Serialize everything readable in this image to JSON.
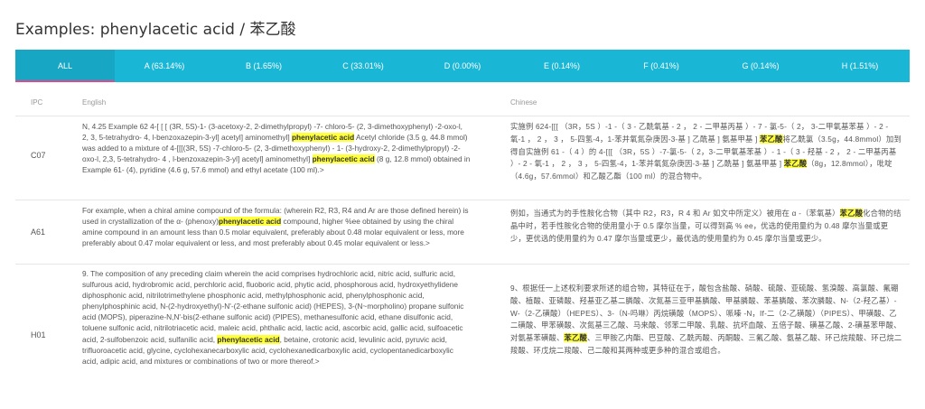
{
  "title": "Examples: phenylacetic acid / 苯乙酸",
  "tabs": [
    {
      "label": "ALL",
      "active": true
    },
    {
      "label": "A (63.14%)"
    },
    {
      "label": "B (1.65%)"
    },
    {
      "label": "C (33.01%)"
    },
    {
      "label": "D (0.00%)"
    },
    {
      "label": "E (0.14%)"
    },
    {
      "label": "F (0.41%)"
    },
    {
      "label": "G (0.14%)"
    },
    {
      "label": "H (1.51%)"
    }
  ],
  "columns": {
    "ipc": "IPC",
    "english": "English",
    "chinese": "Chinese"
  },
  "rows": [
    {
      "ipc": "C07",
      "en_parts": [
        {
          "t": "N, 4.25 Example 62 4-[ [ [ (3R, 5S)-1- (3-acetoxy-2, 2-dimethylpropyl) -7- chloro-5- (2, 3-dimethoxyphenyl) -2-oxo-l, 2, 3, 5-tetrahydro- 4, l-benzoxazepin-3-yl] acetyl] aminomethyl] "
        },
        {
          "t": "phenylacetic acid",
          "hl": true
        },
        {
          "t": " Acetyl chloride (3.5 g, 44.8 mmol) was added to a mixture of 4-[[[(3R, 5S) -7-chloro-5- (2, 3-dimethoxyphenyl) - 1- (3-hydroxy-2, 2-dimethylpropyl) -2-oxo-l, 2,3, 5-tetrahydro- 4 , l-benzoxazepin-3-yl] acetyl] aminomethyl] "
        },
        {
          "t": "phenylacetic acid",
          "hl": true
        },
        {
          "t": " (8 g, 12.8 mmol) obtained in Example 61- (4), pyridine (4.6 g, 57.6 mmol) and ethyl acetate (100 ml).>"
        }
      ],
      "zh_parts": [
        {
          "t": "实施例 624-[[[ （3R，5S ）-1 -（ 3 - 乙酰氧基 - 2 ， 2 - 二甲基丙基 ）- 7 - 氯-5-（ 2， 3-二甲氧基苯基 ）- 2 - 氧-1 ， 2 ， 3 ， 5-四氢-4，1-苯并氧氮杂庚因-3-基 ] 乙酰基 ] 氨基甲基 ] "
        },
        {
          "t": "苯乙酸",
          "hl": true
        },
        {
          "t": "将乙酰氯（3.5g，44.8mmol）加到得自实施例 61 -（ 4 ）的 4-[[[ （3R，5S ）-7-氯-5-（ 2，3-二甲氧基苯基 ）- 1 -（ 3 - 羟基 - 2 ， 2 - 二甲基丙基 ）- 2 - 氧-1 ， 2 ， 3 ， 5-四氢-4，1-苯并氧氮杂庚因-3-基 ] 乙酰基 ] 氨基甲基 ] "
        },
        {
          "t": "苯乙酸",
          "hl": true
        },
        {
          "t": "（8g，12.8mmol），吡啶（4.6g，57.6mmol）和乙酸乙酯（100 ml）的混合物中。"
        }
      ]
    },
    {
      "ipc": "A61",
      "en_parts": [
        {
          "t": "For example, when a chiral amine compound of the formula: (wherein R2, R3, R4 and Ar are those defined herein) is used in crystallization of the α- (phenoxy)"
        },
        {
          "t": "phenylacetic acid",
          "hl": true
        },
        {
          "t": " compound, higher %ee obtained by using the chiral amine compound in an amount less than 0.5 molar equivalent, preferably about 0.48 molar equivalent or less, more preferably about 0.47 molar equivalent or less, and most preferably about 0.45 molar equivalent or less.>"
        }
      ],
      "zh_parts": [
        {
          "t": "例如，当通式为的手性胺化合物（其中 R2，R3，R 4 和 Ar 如文中所定义）被用在 α -（苯氧基）"
        },
        {
          "t": "苯乙酸",
          "hl": true
        },
        {
          "t": "化合物的结晶中时，若手性胺化合物的使用量小于 0.5 摩尔当量，可以得到高 % ee，优选的使用量约为 0.48 摩尔当量或更少，更优选的使用量约为 0.47 摩尔当量或更少，最优选的使用量约为 0.45 摩尔当量或更少。"
        }
      ]
    },
    {
      "ipc": "H01",
      "en_parts": [
        {
          "t": "9. The composition of any preceding claim wherein the acid comprises hydrochloric acid, nitric acid, sulfuric acid, sulfurous acid, hydrobromic acid, perchloric acid, fluoboric acid, phytic acid, phosphorous acid, hydroxyethylidene diphosphonic acid, nitrilotrimethylene phosphonic acid, methylphosphonic acid, phenylphosphonic acid, phenylphosphinic acid, N-(2-hydroxyethyl)-N'-(2-ethane sulfonic acid) (HEPES), 3-(N~morpholino) propane sulfonic acid (MOPS), piperazine-N,N'-bis(2-ethane sulfonic acid) (PIPES), methanesulfonic acid, ethane disulfonic acid, toluene sulfonic acid, nitrilotriacetic acid, maleic acid, phthalic acid, lactic acid, ascorbic acid, gallic acid, sulfoacetic acid, 2-sulfobenzoic acid, sulfanilic acid, "
        },
        {
          "t": "phenylacetic acid",
          "hl": true
        },
        {
          "t": ", betaine, crotonic acid, levulinic acid, pyruvic acid, trifluoroacetic acid, glycine, cyclohexanecarboxylic acid, cyclohexanedicarboxylic acid, cyclopentanedicarboxylic acid, adipic acid, and mixtures or combinations of two or more thereof.>"
        }
      ],
      "zh_parts": [
        {
          "t": "9、根据任一上述权利要求所述的组合物，其特征在于，酸包含盐酸、硝酸、硫酸、亚硫酸、氢溴酸、高氯酸、氟硼酸、植酸、亚磷酸、羟基亚乙基二膦酸、次氮基三亚甲基膦酸、甲基膦酸、苯基膦酸、苯次膦酸、N-（2-羟乙基）-W-（2-乙磺酸）（HEPES）、3-（N-吗啉）丙烷磺酸（MOPS）、哌嗪 -N，If-二（2-乙磺酸）（PIPES）、甲磺酸、乙二磺酸、甲苯磺酸、次氮基三乙酸、马来酸、邻苯二甲酸、乳酸、抗坏血酸、五倍子酸、磺基乙酸、2-磺基苯甲酸、对氨基苯磺酸、"
        },
        {
          "t": "苯乙酸",
          "hl": true
        },
        {
          "t": "、三甲胺乙内酯、巴豆酸、乙酰丙酸、丙酮酸、三氟乙酸、氨基乙酸、环己烷羧酸、环己烷二羧酸、环戊烷二羧酸、己二酸和其两种或更多种的混合或组合。"
        }
      ]
    }
  ]
}
